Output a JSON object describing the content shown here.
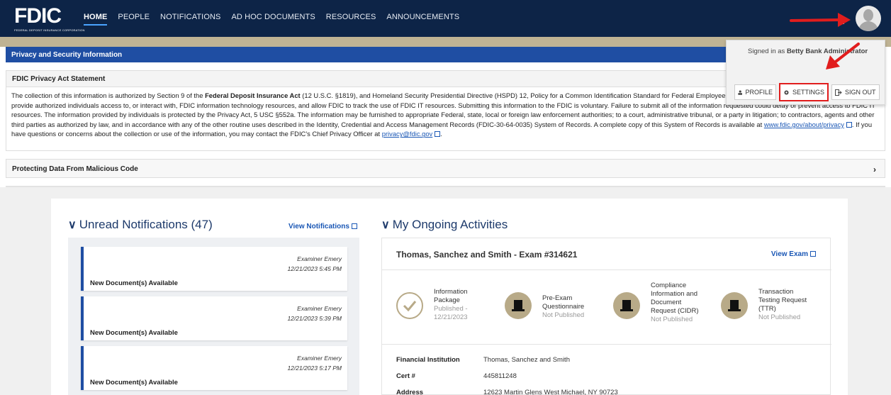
{
  "nav": {
    "logo_text": "FDIC",
    "logo_subtext": "FEDERAL DEPOSIT INSURANCE CORPORATION",
    "items": [
      {
        "label": "HOME"
      },
      {
        "label": "PEOPLE"
      },
      {
        "label": "NOTIFICATIONS"
      },
      {
        "label": "AD HOC DOCUMENTS"
      },
      {
        "label": "RESOURCES"
      },
      {
        "label": "ANNOUNCEMENTS"
      }
    ]
  },
  "user_menu": {
    "signed_in_prefix": "Signed in as ",
    "user_name": "Betty Bank Administrator",
    "profile_label": "PROFILE",
    "settings_label": "SETTINGS",
    "signout_label": "SIGN OUT"
  },
  "privacy": {
    "bar_title": "Privacy and Security Information",
    "statement_header": "FDIC Privacy Act Statement",
    "p1": "The collection of this information is authorized by Section 9 of the ",
    "act_name": "Federal Deposit Insurance Act",
    "p2": " (12 U.S.C. §1819), and Homeland Security Presidential Directive (HSPD) 12, Policy for a Common Identification Standard for Federal Employees.  The FDIC will use this information in order to provide authorized individuals access to, or interact with, FDIC information technology resources, and allow FDIC to track the use of FDIC IT resources. Submitting this information to the FDIC is voluntary.  Failure to submit all of the information requested could delay or prevent access to FDIC IT resources. The information provided by individuals is protected by the Privacy Act, 5 USC §552a.  The information may be furnished to appropriate Federal, state, local or foreign law enforcement authorities; to a court, administrative tribunal, or a party in litigation; to contractors, agents and other third parties as authorized by law, and in accordance with any of the other routine uses described in the Identity, Credential and Access Management Records (FDIC-30-64-0035) System of Records.  A complete copy of this System of Records is available at ",
    "link1": "www.fdic.gov/about/privacy",
    "p3": ". If you have questions or concerns about the collection or use of the information, you may contact the FDIC's Chief Privacy Officer at ",
    "link2": "privacy@fdic.gov",
    "p4": ".",
    "protect_header": "Protecting Data From Malicious Code"
  },
  "notifications": {
    "title": "Unread Notifications (47)",
    "view_link": "View Notifications",
    "items": [
      {
        "author": "Examiner Emery",
        "time": "12/21/2023 5:45 PM",
        "label": "New Document(s) Available"
      },
      {
        "author": "Examiner Emery",
        "time": "12/21/2023 5:39 PM",
        "label": "New Document(s) Available"
      },
      {
        "author": "Examiner Emery",
        "time": "12/21/2023 5:17 PM",
        "label": "New Document(s) Available"
      }
    ]
  },
  "activities": {
    "title": "My Ongoing Activities",
    "exam_title": "Thomas, Sanchez and Smith - Exam #314621",
    "view_exam": "View Exam",
    "steps": [
      {
        "l1": "Information",
        "l2": "Package",
        "status1": "Published -",
        "status2": "12/21/2023"
      },
      {
        "l1": "Pre-Exam",
        "l2": "Questionnaire",
        "status1": "Not Published"
      },
      {
        "l1": "Compliance",
        "l2": "Information and",
        "l3": "Document",
        "l4": "Request (CIDR)",
        "status1": "Not Published"
      },
      {
        "l1": "Transaction",
        "l2": "Testing Request",
        "l3": "(TTR)",
        "status1": "Not Published"
      }
    ],
    "info": [
      {
        "k": "Financial Institution",
        "v": "Thomas, Sanchez and Smith"
      },
      {
        "k": "Cert #",
        "v": "445811248"
      },
      {
        "k": "Address",
        "v": "12623 Martin Glens West Michael, NY 90723"
      }
    ]
  },
  "colors": {
    "nav_bg": "#0d2447",
    "accent_blue": "#1f4ea3",
    "highlight_red": "#e11d1d",
    "step_tan": "#b8aa88"
  }
}
